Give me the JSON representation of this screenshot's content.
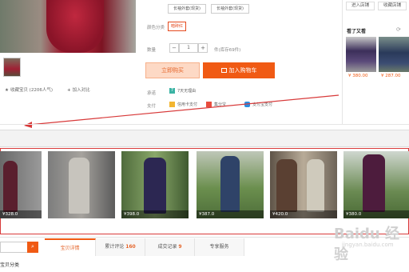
{
  "product": {
    "variant_options": [
      "长袖外套(现货)",
      "长袖外套(现货)"
    ],
    "color_label": "颜色分类",
    "color_option": "暗砖红",
    "qty_label": "数量",
    "qty_value": "1",
    "stock_text": "件(库存69件)",
    "buy_now": "立即购买",
    "add_cart": "加入购物车",
    "promise_label": "承诺",
    "promise_text": "7天无理由",
    "pay_label": "支付",
    "pay_methods": [
      "信用卡支付",
      "集分宝",
      "支付宝支付"
    ],
    "favorite": "收藏宝贝 (2206人气)",
    "compare": "加入对比"
  },
  "right_panel": {
    "enter_shop": "进入店铺",
    "fav_shop": "收藏店铺",
    "title": "看了又看",
    "prices": [
      "¥ 380.00",
      "¥ 287.00"
    ]
  },
  "gallery": {
    "prices": [
      "¥328.0",
      "",
      "¥398.0",
      "",
      "¥387.0",
      "¥420.0",
      "¥380.0"
    ]
  },
  "tabs": [
    {
      "label": "宝贝详情",
      "count": ""
    },
    {
      "label": "累计评论",
      "count": "160"
    },
    {
      "label": "成交记录",
      "count": "9"
    },
    {
      "label": "专享服务",
      "count": ""
    }
  ],
  "search_icon": "search-icon",
  "category_text": "宝贝分类",
  "watermark": "Baidu 经验",
  "watermark_url": "jingyan.baidu.com",
  "colors": {
    "accent": "#f05a14",
    "annotation": "#d83a3a"
  }
}
